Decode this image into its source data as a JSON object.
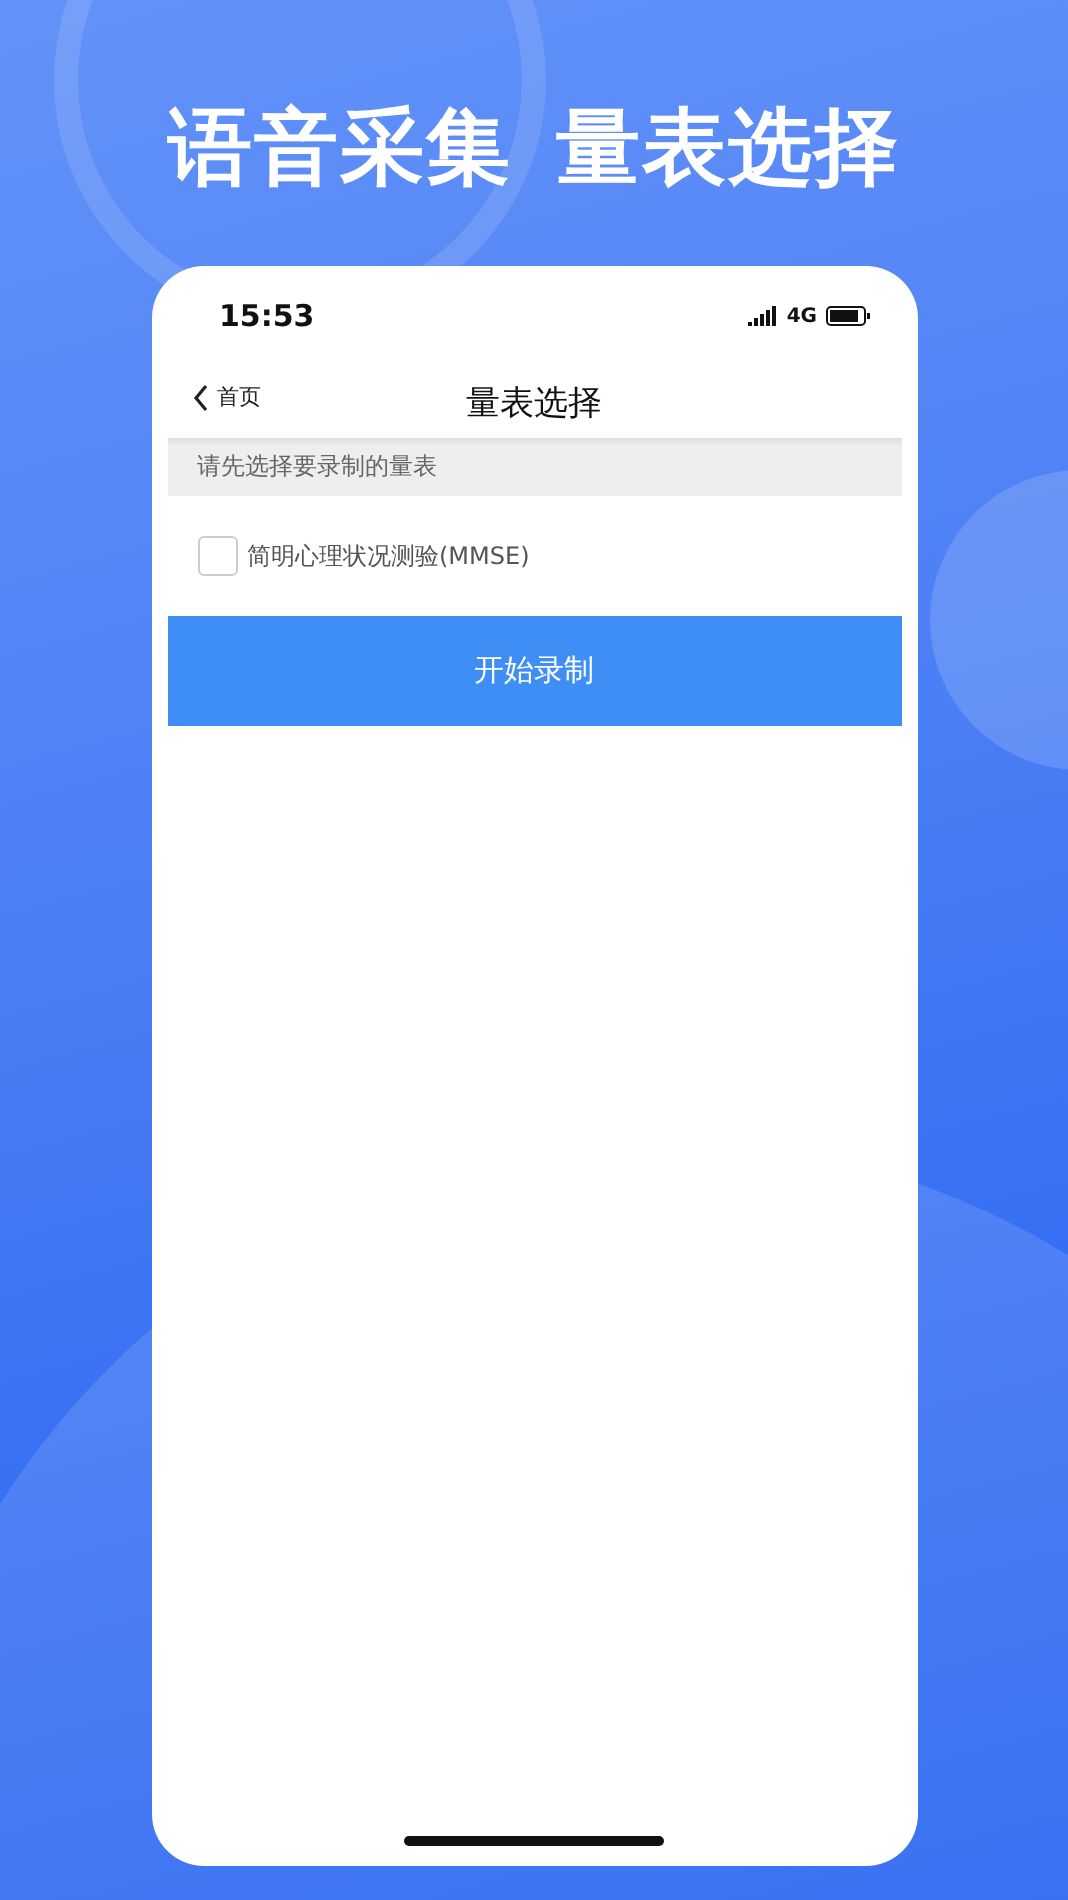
{
  "headline": [
    "语音采集",
    "量表选择"
  ],
  "status_bar": {
    "time": "15:53",
    "network": "4G"
  },
  "nav": {
    "back": "首页",
    "title": "量表选择"
  },
  "hint": "请先选择要录制的量表",
  "scales": [
    {
      "label": "简明心理状况测验(MMSE)",
      "checked": false
    }
  ],
  "button": "开始录制"
}
